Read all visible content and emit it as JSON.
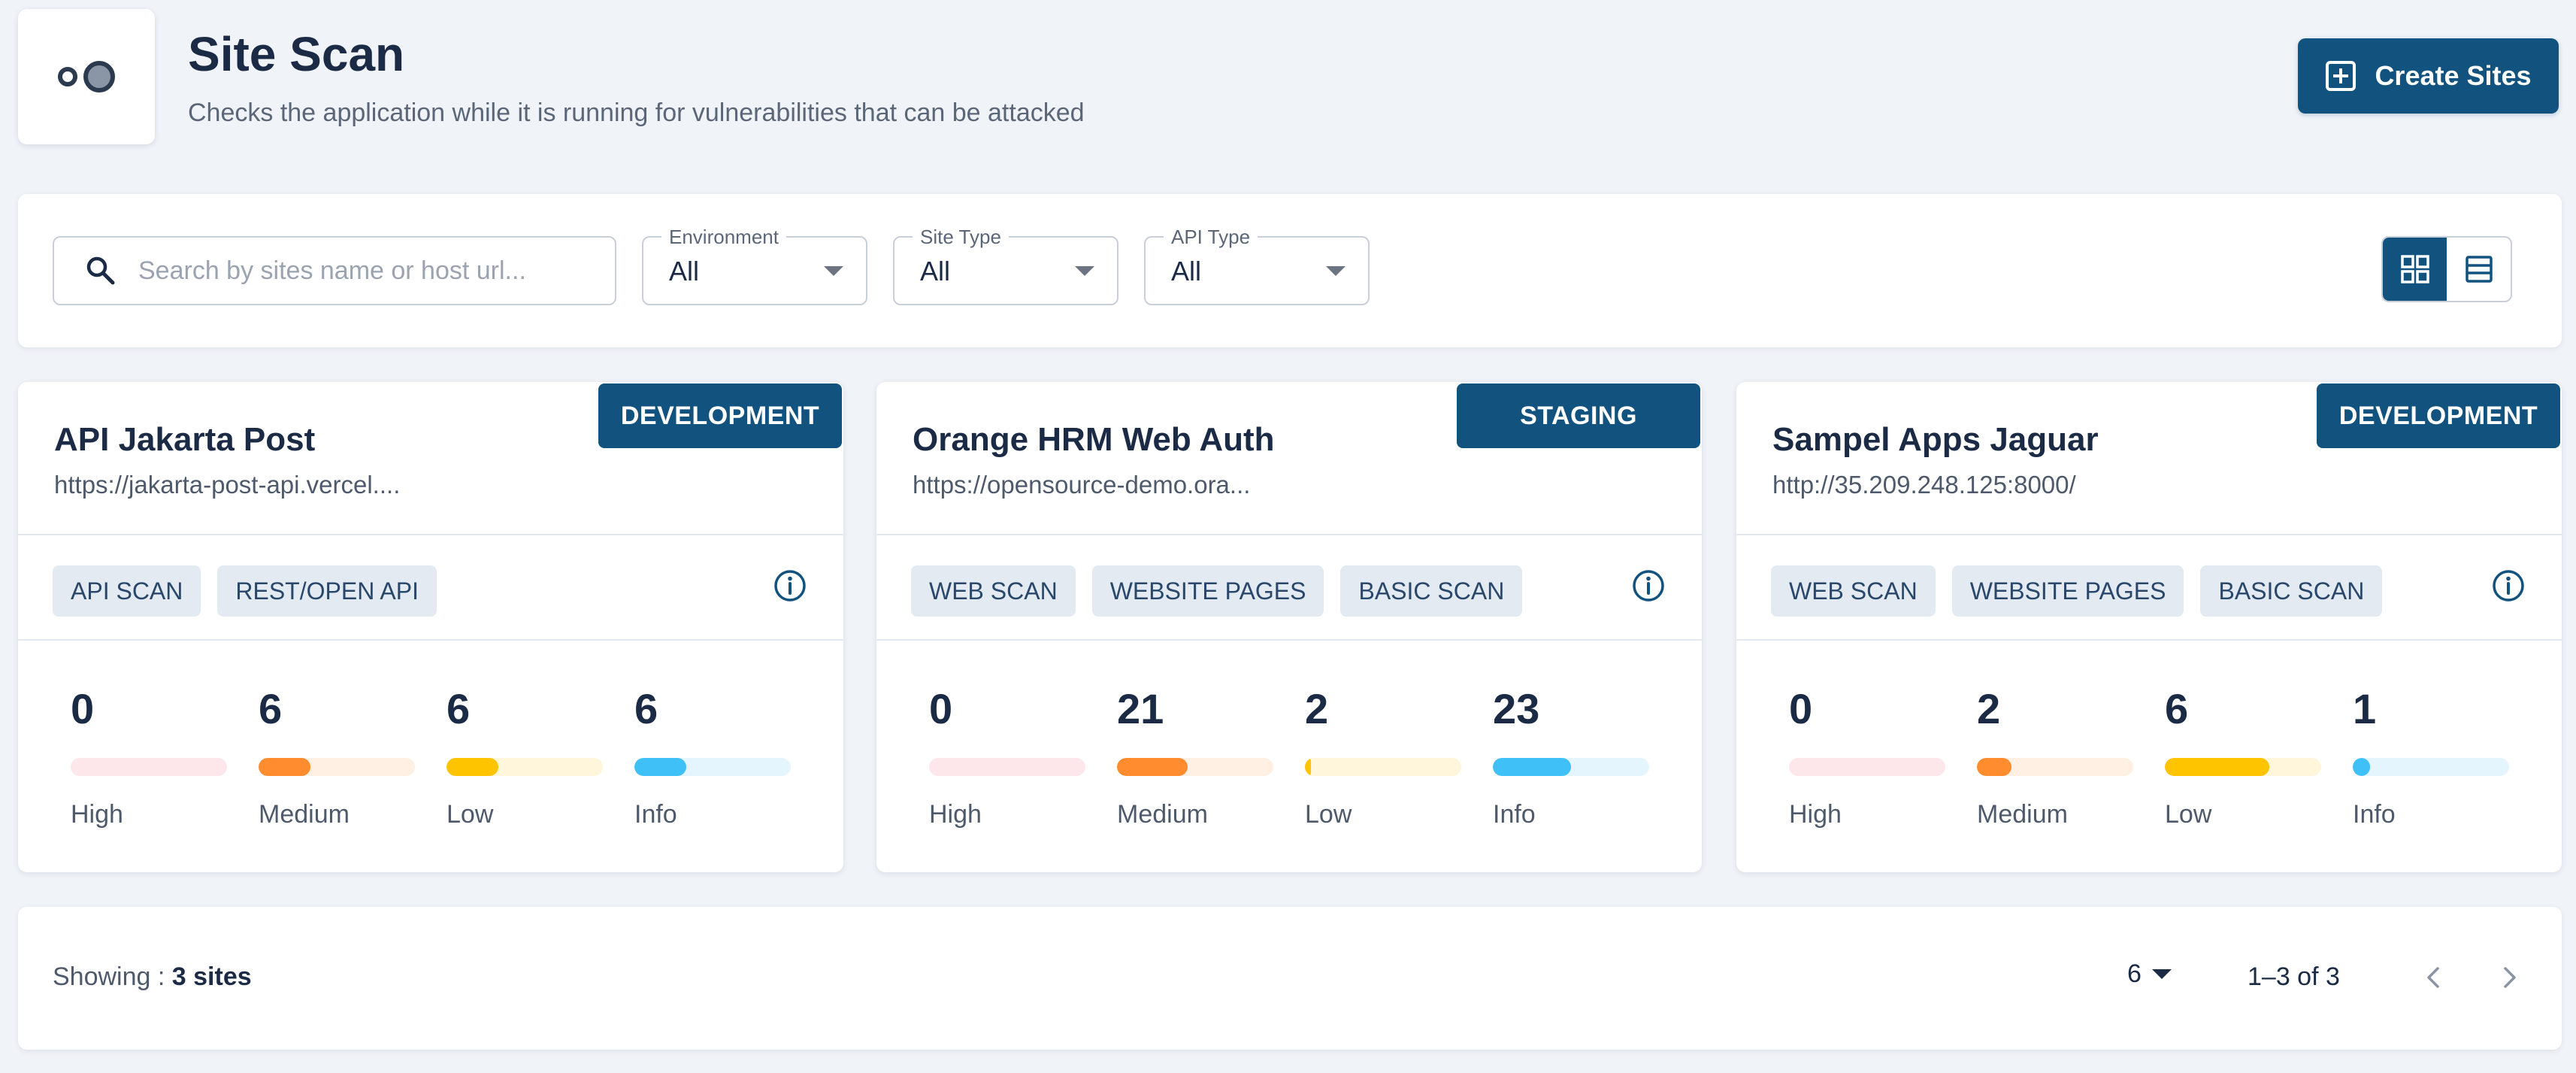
{
  "header": {
    "title": "Site Scan",
    "subtitle": "Checks the application while it is running for vulnerabilities that can be attacked",
    "create_label": "Create Sites"
  },
  "filters": {
    "search_placeholder": "Search by sites name or host url...",
    "environment": {
      "label": "Environment",
      "value": "All"
    },
    "site_type": {
      "label": "Site Type",
      "value": "All"
    },
    "api_type": {
      "label": "API Type",
      "value": "All"
    },
    "view_mode": "grid"
  },
  "severity_colors": {
    "high": {
      "fill": "#ffd0d5",
      "track": "#fde7ea"
    },
    "medium": {
      "fill": "#ff8c2f",
      "track": "#fff0e3"
    },
    "low": {
      "fill": "#ffc400",
      "track": "#fff6dc"
    },
    "info": {
      "fill": "#3fc0f7",
      "track": "#e5f5fd"
    }
  },
  "sites": [
    {
      "name": "API Jakarta Post",
      "url": "https://jakarta-post-api.vercel....",
      "environment": "DEVELOPMENT",
      "tags": [
        "API SCAN",
        "REST/OPEN API"
      ],
      "stats": [
        {
          "label": "High",
          "value": "0",
          "level": 0
        },
        {
          "label": "Medium",
          "value": "6",
          "level": 0.33
        },
        {
          "label": "Low",
          "value": "6",
          "level": 0.33
        },
        {
          "label": "Info",
          "value": "6",
          "level": 0.33
        }
      ]
    },
    {
      "name": "Orange HRM Web Auth",
      "url": "https://opensource-demo.ora...",
      "environment": "STAGING",
      "tags": [
        "WEB SCAN",
        "WEBSITE PAGES",
        "BASIC SCAN"
      ],
      "stats": [
        {
          "label": "High",
          "value": "0",
          "level": 0
        },
        {
          "label": "Medium",
          "value": "21",
          "level": 0.45
        },
        {
          "label": "Low",
          "value": "2",
          "level": 0.04
        },
        {
          "label": "Info",
          "value": "23",
          "level": 0.5
        }
      ]
    },
    {
      "name": "Sampel Apps Jaguar",
      "url": "http://35.209.248.125:8000/",
      "environment": "DEVELOPMENT",
      "tags": [
        "WEB SCAN",
        "WEBSITE PAGES",
        "BASIC SCAN"
      ],
      "stats": [
        {
          "label": "High",
          "value": "0",
          "level": 0
        },
        {
          "label": "Medium",
          "value": "2",
          "level": 0.22
        },
        {
          "label": "Low",
          "value": "6",
          "level": 0.67
        },
        {
          "label": "Info",
          "value": "1",
          "level": 0.11
        }
      ]
    }
  ],
  "footer": {
    "showing_label": "Showing :",
    "showing_value": "3 sites",
    "per_page": "6",
    "range": "1–3 of 3"
  }
}
